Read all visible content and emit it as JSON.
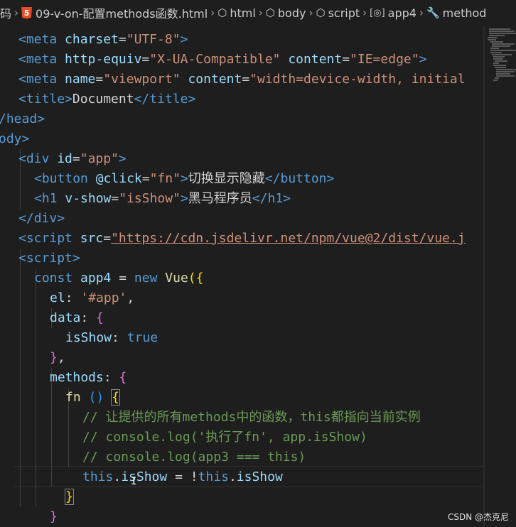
{
  "breadcrumb": {
    "items": [
      "码",
      "09-v-on-配置methods函数.html",
      "html",
      "body",
      "script",
      "app4",
      "method"
    ]
  },
  "code_lines": [
    [
      [
        "tag",
        "<"
      ],
      [
        "tag",
        "meta"
      ],
      [
        "plain",
        " "
      ],
      [
        "attr",
        "charset"
      ],
      [
        "plain",
        "="
      ],
      [
        "str",
        "\"UTF-8\""
      ],
      [
        "tag",
        ">"
      ]
    ],
    [
      [
        "tag",
        "<"
      ],
      [
        "tag",
        "meta"
      ],
      [
        "plain",
        " "
      ],
      [
        "attr",
        "http-equiv"
      ],
      [
        "plain",
        "="
      ],
      [
        "str",
        "\"X-UA-Compatible\""
      ],
      [
        "plain",
        " "
      ],
      [
        "attr",
        "content"
      ],
      [
        "plain",
        "="
      ],
      [
        "str",
        "\"IE=edge\""
      ],
      [
        "tag",
        ">"
      ]
    ],
    [
      [
        "tag",
        "<"
      ],
      [
        "tag",
        "meta"
      ],
      [
        "plain",
        " "
      ],
      [
        "attr",
        "name"
      ],
      [
        "plain",
        "="
      ],
      [
        "str",
        "\"viewport\""
      ],
      [
        "plain",
        " "
      ],
      [
        "attr",
        "content"
      ],
      [
        "plain",
        "="
      ],
      [
        "str",
        "\"width=device-width, initial"
      ]
    ],
    [
      [
        "tag",
        "<"
      ],
      [
        "tag",
        "title"
      ],
      [
        "tag",
        ">"
      ],
      [
        "plain",
        "Document"
      ],
      [
        "tag",
        "</"
      ],
      [
        "tag",
        "title"
      ],
      [
        "tag",
        ">"
      ]
    ],
    [
      [
        "tag",
        "/head"
      ],
      [
        "tag",
        ">"
      ]
    ],
    [
      [
        "tag",
        "ody"
      ],
      [
        "tag",
        ">"
      ]
    ],
    [
      [
        "tag",
        "<"
      ],
      [
        "tag",
        "div"
      ],
      [
        "plain",
        " "
      ],
      [
        "attr",
        "id"
      ],
      [
        "plain",
        "="
      ],
      [
        "str",
        "\"app\""
      ],
      [
        "tag",
        ">"
      ]
    ],
    [
      [
        "tag",
        "<"
      ],
      [
        "tag",
        "button"
      ],
      [
        "plain",
        " "
      ],
      [
        "attr",
        "@click"
      ],
      [
        "plain",
        "="
      ],
      [
        "str",
        "\"fn\""
      ],
      [
        "tag",
        ">"
      ],
      [
        "plain",
        "切换显示隐藏"
      ],
      [
        "tag",
        "</"
      ],
      [
        "tag",
        "button"
      ],
      [
        "tag",
        ">"
      ]
    ],
    [
      [
        "tag",
        "<"
      ],
      [
        "tag",
        "h1"
      ],
      [
        "plain",
        " "
      ],
      [
        "attr",
        "v-show"
      ],
      [
        "plain",
        "="
      ],
      [
        "str",
        "\"isShow\""
      ],
      [
        "tag",
        ">"
      ],
      [
        "plain",
        "黑马程序员"
      ],
      [
        "tag",
        "</"
      ],
      [
        "tag",
        "h1"
      ],
      [
        "tag",
        ">"
      ]
    ],
    [
      [
        "tag",
        "</"
      ],
      [
        "tag",
        "div"
      ],
      [
        "tag",
        ">"
      ]
    ],
    [
      [
        "tag",
        "<"
      ],
      [
        "tag",
        "script"
      ],
      [
        "plain",
        " "
      ],
      [
        "attr",
        "src"
      ],
      [
        "plain",
        "="
      ],
      [
        "url",
        "\"https://cdn.jsdelivr.net/npm/vue@2/dist/vue.j"
      ]
    ],
    [
      [
        "tag",
        "<"
      ],
      [
        "tag",
        "script"
      ],
      [
        "tag",
        ">"
      ]
    ],
    [
      [
        "kw",
        "const"
      ],
      [
        "plain",
        " "
      ],
      [
        "prop",
        "app4"
      ],
      [
        "plain",
        " = "
      ],
      [
        "kw",
        "new"
      ],
      [
        "plain",
        " "
      ],
      [
        "fn",
        "Vue"
      ],
      [
        "br1",
        "({"
      ]
    ],
    [
      [
        "prop",
        "el"
      ],
      [
        "plain",
        ": "
      ],
      [
        "str",
        "'#app'"
      ],
      [
        "plain",
        ","
      ]
    ],
    [
      [
        "prop",
        "data"
      ],
      [
        "plain",
        ": "
      ],
      [
        "br2",
        "{"
      ]
    ],
    [
      [
        "prop",
        "isShow"
      ],
      [
        "plain",
        ": "
      ],
      [
        "kw",
        "true"
      ]
    ],
    [
      [
        "br2",
        "}"
      ],
      [
        "plain",
        ","
      ]
    ],
    [
      [
        "prop",
        "methods"
      ],
      [
        "plain",
        ": "
      ],
      [
        "br2",
        "{"
      ]
    ],
    [
      [
        "fn",
        "fn"
      ],
      [
        "plain",
        " "
      ],
      [
        "br3",
        "()"
      ],
      [
        "plain",
        " "
      ],
      [
        "box",
        "{"
      ]
    ],
    [
      [
        "cm",
        "// 让提供的所有methods中的函数，this都指向当前实例"
      ]
    ],
    [
      [
        "cm",
        "// console.log('执行了fn', app.isShow)"
      ]
    ],
    [
      [
        "cm",
        "// console.log(app3 === this)"
      ]
    ],
    [
      [
        "kw",
        "this"
      ],
      [
        "plain",
        "."
      ],
      [
        "prop",
        "isShow"
      ],
      [
        "plain",
        " = !"
      ],
      [
        "kw",
        "this"
      ],
      [
        "plain",
        "."
      ],
      [
        "prop",
        "isShow"
      ]
    ],
    [
      [
        "box",
        "}"
      ]
    ],
    [
      [
        "br2",
        "}"
      ]
    ]
  ],
  "watermark": "CSDN @杰克尼"
}
